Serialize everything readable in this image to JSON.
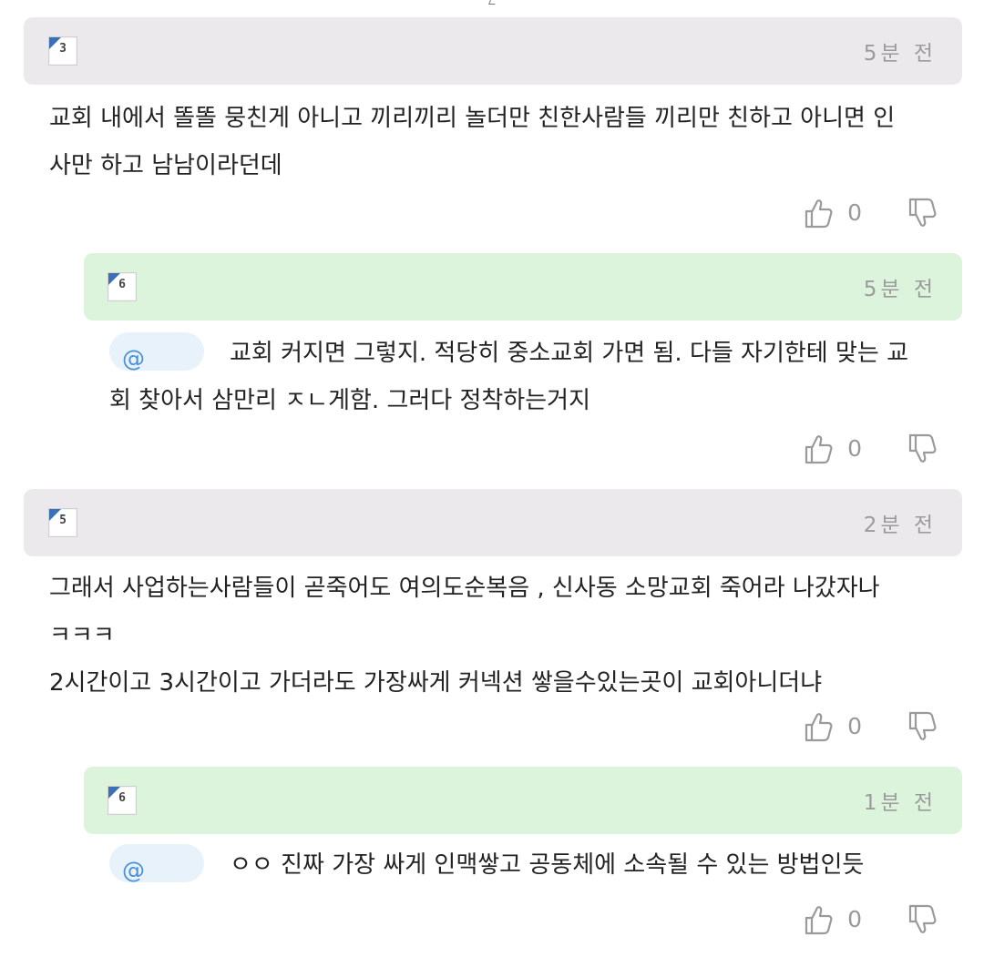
{
  "comments": [
    {
      "avatar_glyph": "3",
      "time": "5분 전",
      "text": "교회 내에서 똘똘 뭉친게 아니고 끼리끼리 놀더만 친한사람들 끼리만 친하고 아니면 인\n사만 하고 남남이라던데",
      "likes": "0"
    },
    {
      "avatar_glyph": "6",
      "time": "5분 전",
      "mention": "@",
      "text": "교회 커지면 그렇지. 적당히 중소교회 가면 됨. 다들 자기한테 맞는 교\n회 찾아서 삼만리 ㅈㄴ게함. 그러다 정착하는거지",
      "likes": "0"
    },
    {
      "avatar_glyph": "5",
      "time": "2분 전",
      "text": "그래서 사업하는사람들이 곧죽어도 여의도순복음 , 신사동 소망교회 죽어라 나갔자나\nㅋㅋㅋ\n2시간이고 3시간이고 가더라도 가장싸게 커넥션 쌓을수있는곳이 교회아니더냐",
      "likes": "0"
    },
    {
      "avatar_glyph": "6",
      "time": "1분 전",
      "mention": "@",
      "text": "ㅇㅇ 진짜 가장 싸게 인맥쌓고 공동체에 소속될 수 있는 방법인듯",
      "likes": "0"
    }
  ],
  "icons": {
    "like": "thumbs-up-icon",
    "dislike": "thumbs-down-icon"
  },
  "colors": {
    "top_header": "#ece9ed",
    "reply_header": "#dcf4dc",
    "mention_bg": "#e8f2fb",
    "mention_text": "#4a90d9",
    "avatar_corner": "#3b6fb6"
  }
}
